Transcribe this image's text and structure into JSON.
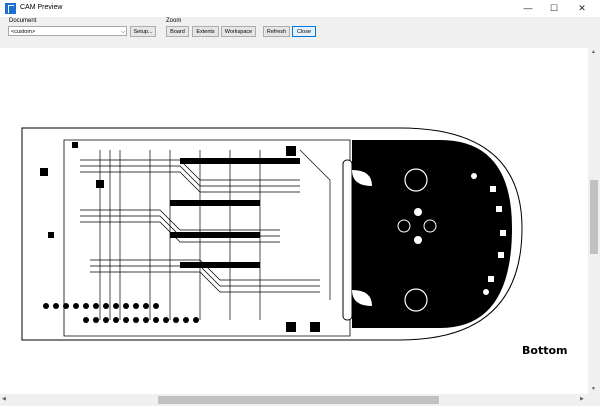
{
  "window": {
    "title": "CAM Preview",
    "controls": {
      "minimize": "—",
      "maximize": "☐",
      "close": "✕"
    }
  },
  "toolbar": {
    "document_label": "Document",
    "document_value": "<custom>",
    "setup_label": "Setup...",
    "zoom_label": "Zoom",
    "board_label": "Board",
    "extents_label": "Extents",
    "workspace_label": "Workspace",
    "refresh_label": "Refresh",
    "close_label": "Close"
  },
  "preview": {
    "layer_label": "Bottom"
  }
}
